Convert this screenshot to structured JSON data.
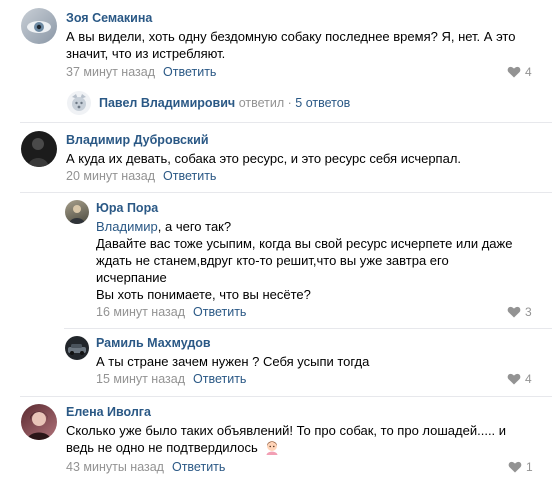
{
  "comments": [
    {
      "author": "Зоя Семакина",
      "text_lines": [
        "А вы видели, хоть одну бездомную собаку последнее время? Я, нет. А это",
        "значит, что из истребляют."
      ],
      "time": "37 минут назад",
      "reply_label": "Ответить",
      "likes": "4"
    },
    {
      "author": "Владимир Дубровский",
      "text_lines": [
        "А куда их девать, собака это ресурс, и это ресурс себя исчерпал."
      ],
      "time": "20 минут назад",
      "reply_label": "Ответить",
      "likes": ""
    },
    {
      "author": "Юра Пора",
      "mention": "Владимир",
      "text_lines": [
        ", а чего так?",
        "Давайте вас тоже усыпим, когда вы свой ресурс исчерпете или даже",
        "ждать не станем,вдруг кто-то решит,что вы уже завтра его",
        "исчерпание",
        "Вы хоть понимаете, что вы несёте?"
      ],
      "time": "16 минут назад",
      "reply_label": "Ответить",
      "likes": "3"
    },
    {
      "author": "Рамиль Махмудов",
      "text_lines": [
        "А ты стране зачем нужен ? Себя усыпи тогда"
      ],
      "time": "15 минут назад",
      "reply_label": "Ответить",
      "likes": "4"
    },
    {
      "author": "Елена Иволга",
      "text_lines": [
        "Сколько уже было таких объявлений! То про собак, то про лошадей..... и",
        "ведь не одно не подтвердилось"
      ],
      "time": "43 минуты назад",
      "reply_label": "Ответить",
      "likes": "1"
    }
  ],
  "thread": {
    "author": "Павел Владимирович",
    "verb": "ответил",
    "separator": "·",
    "count": "5 ответов"
  },
  "colors": {
    "link": "#2a5885",
    "meta": "#939393",
    "separator": "#e7e8ec"
  },
  "icons": {
    "like": "heart-icon",
    "emoji": "girl-emoji-icon"
  }
}
